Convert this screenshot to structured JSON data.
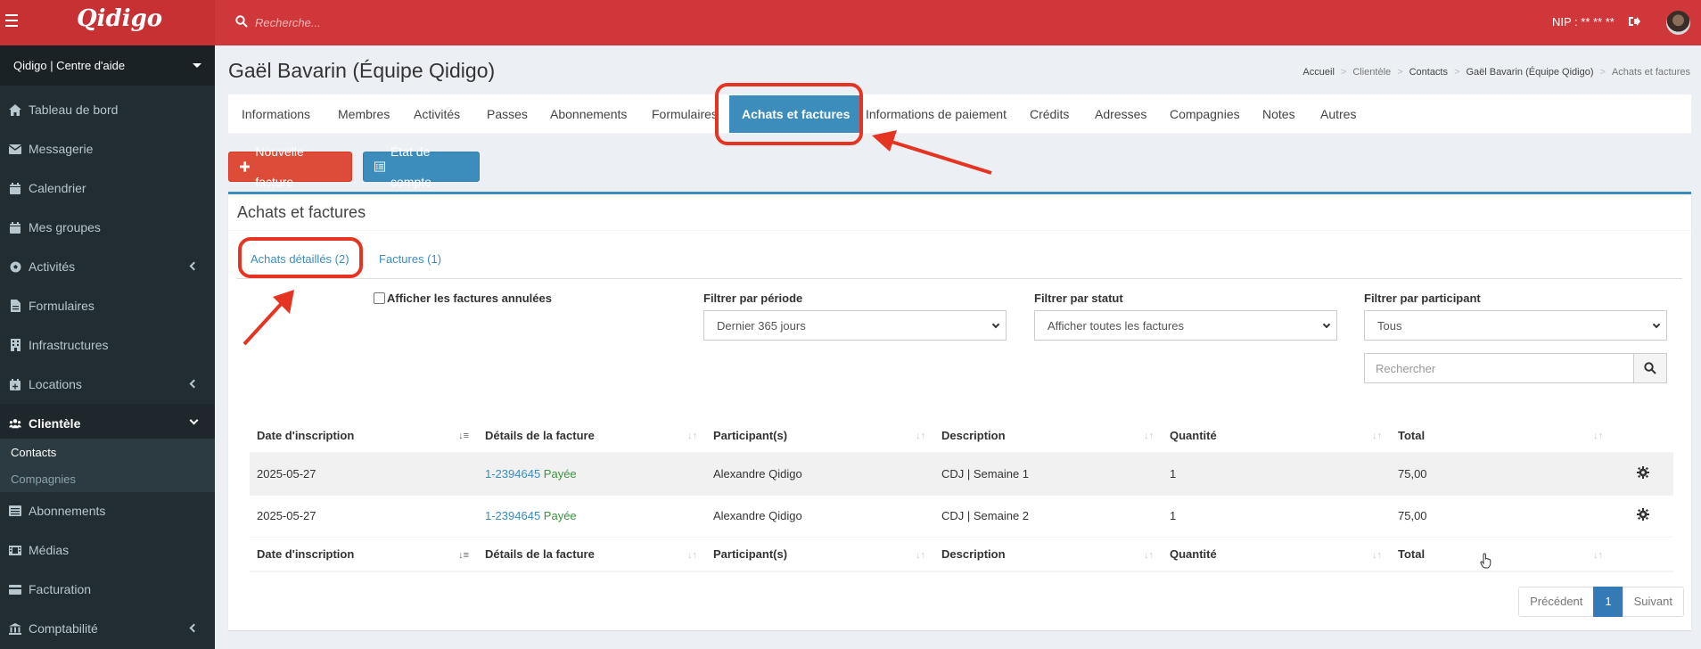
{
  "brand": {
    "logo_text": "Qidigo"
  },
  "topbar": {
    "search_placeholder": "Recherche...",
    "nip": "NIP : ** ** **"
  },
  "sidebar": {
    "site_select": "Qidigo | Centre d'aide",
    "items": [
      {
        "label": "Tableau de bord",
        "icon": "home-icon"
      },
      {
        "label": "Messagerie",
        "icon": "envelope-icon"
      },
      {
        "label": "Calendrier",
        "icon": "calendar-icon"
      },
      {
        "label": "Mes groupes",
        "icon": "calendar-icon"
      },
      {
        "label": "Activités",
        "icon": "soccer-ball-icon"
      },
      {
        "label": "Formulaires",
        "icon": "file-icon"
      },
      {
        "label": "Infrastructures",
        "icon": "building-icon"
      },
      {
        "label": "Locations",
        "icon": "calendar-plus-icon"
      },
      {
        "label": "Clientèle",
        "icon": "users-icon"
      },
      {
        "label": "Abonnements",
        "icon": "list-icon"
      },
      {
        "label": "Médias",
        "icon": "film-icon"
      },
      {
        "label": "Facturation",
        "icon": "credit-card-icon"
      },
      {
        "label": "Comptabilité",
        "icon": "bank-icon"
      }
    ],
    "sub_items": [
      "Contacts",
      "Compagnies"
    ]
  },
  "page": {
    "title": "Gaël Bavarin (Équipe Qidigo)",
    "breadcrumb": [
      "Accueil",
      "Clientèle",
      "Contacts",
      "Gaël Bavarin (Équipe Qidigo)",
      "Achats et factures"
    ]
  },
  "tabs": [
    "Informations",
    "Membres",
    "Activités",
    "Passes",
    "Abonnements",
    "Formulaires",
    "Achats et factures",
    "Informations de paiement",
    "Crédits",
    "Adresses",
    "Compagnies",
    "Notes",
    "Autres"
  ],
  "buttons": {
    "new_invoice": "Nouvelle facture",
    "statement": "État de compte"
  },
  "box": {
    "title": "Achats et factures",
    "subtabs": [
      "Achats détaillés (2)",
      "Factures (1)"
    ],
    "show_cancelled": "Afficher les factures annulées",
    "filters": {
      "period_label": "Filtrer par période",
      "period_value": "Dernier 365 jours",
      "status_label": "Filtrer par statut",
      "status_value": "Afficher toutes les factures",
      "participant_label": "Filtrer par participant",
      "participant_value": "Tous",
      "search_placeholder": "Rechercher"
    }
  },
  "table": {
    "headers": [
      "Date d'inscription",
      "Détails de la facture",
      "Participant(s)",
      "Description",
      "Quantité",
      "Total"
    ],
    "rows": [
      {
        "date": "2025-05-27",
        "invoice": "1-2394645",
        "status": "Payée",
        "participant": "Alexandre Qidigo",
        "description": "CDJ | Semaine 1",
        "quantity": "1",
        "total": "75,00"
      },
      {
        "date": "2025-05-27",
        "invoice": "1-2394645",
        "status": "Payée",
        "participant": "Alexandre Qidigo",
        "description": "CDJ | Semaine 2",
        "quantity": "1",
        "total": "75,00"
      }
    ]
  },
  "pagination": {
    "prev": "Précédent",
    "current": "1",
    "next": "Suivant"
  },
  "colors": {
    "header_red": "#d0373b",
    "sidebar": "#222d32",
    "primary_blue": "#3c8dbc",
    "annotation_red": "#e53421"
  }
}
